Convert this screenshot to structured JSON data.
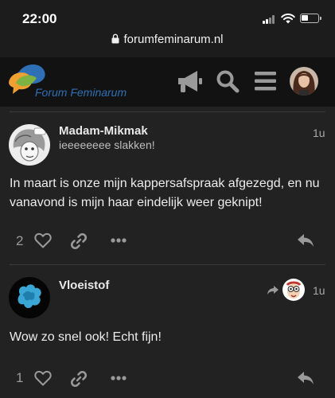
{
  "status": {
    "time": "22:00"
  },
  "browser": {
    "url": "forumfeminarum.nl"
  },
  "header": {
    "logo_text": "Forum Feminarum"
  },
  "posts": [
    {
      "username": "Madam-Mikmak",
      "user_title": "ieeeeeeee slakken!",
      "age": "1u",
      "body": "In maart is onze mijn kappersafspraak afgezegd, en nu vanavond is mijn haar eindelijk weer geknipt!",
      "likes": "2"
    },
    {
      "username": "Vloeistof",
      "user_title": "",
      "age": "1u",
      "body": "Wow zo snel ook! Echt fijn!",
      "likes": "1"
    }
  ],
  "colors": {
    "background": "#222222",
    "header": "#121212",
    "logo_blue": "#2f6fb5",
    "logo_green": "#7cb342",
    "logo_orange": "#f0a030",
    "icon_gray": "#9a9a9a"
  }
}
